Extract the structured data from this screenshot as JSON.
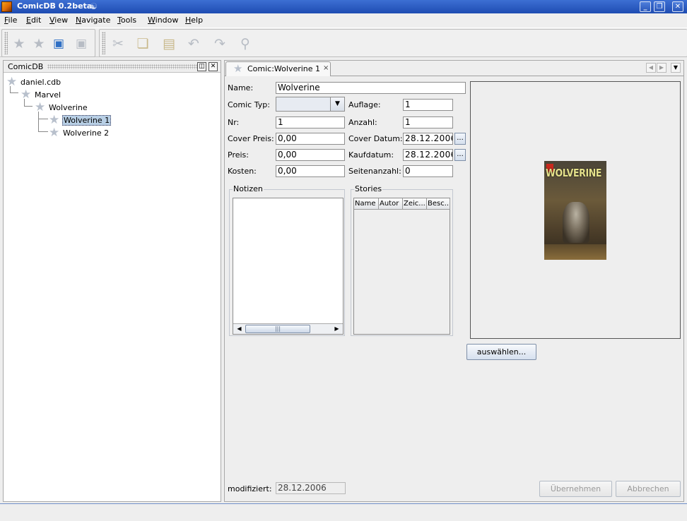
{
  "window": {
    "title": "ComicDB 0.2beta"
  },
  "menu": [
    "File",
    "Edit",
    "View",
    "Navigate",
    "Tools",
    "Window",
    "Help"
  ],
  "toolbar": {
    "icons": [
      "star-icon",
      "star-add-icon",
      "save-icon",
      "save-all-icon",
      "cut-icon",
      "copy-icon",
      "paste-icon",
      "undo-icon",
      "redo-icon",
      "find-icon"
    ]
  },
  "left_panel": {
    "title": "ComicDB",
    "tree": [
      {
        "label": "daniel.cdb",
        "level": 0
      },
      {
        "label": "Marvel",
        "level": 1
      },
      {
        "label": "Wolverine",
        "level": 2
      },
      {
        "label": "Wolverine 1",
        "level": 3,
        "selected": true
      },
      {
        "label": "Wolverine 2",
        "level": 3
      }
    ]
  },
  "tab": {
    "label": "Comic:Wolverine 1",
    "close": "×"
  },
  "form": {
    "name_label": "Name:",
    "name_value": "Wolverine",
    "comic_typ_label": "Comic Typ:",
    "comic_typ_value": "",
    "auflage_label": "Auflage:",
    "auflage_value": "1",
    "nr_label": "Nr:",
    "nr_value": "1",
    "anzahl_label": "Anzahl:",
    "anzahl_value": "1",
    "cover_preis_label": "Cover Preis:",
    "cover_preis_value": "0,00",
    "cover_datum_label": "Cover Datum:",
    "cover_datum_value": "28.12.2006",
    "preis_label": "Preis:",
    "preis_value": "0,00",
    "kaufdatum_label": "Kaufdatum:",
    "kaufdatum_value": "28.12.2006",
    "kosten_label": "Kosten:",
    "kosten_value": "0,00",
    "seitenanzahl_label": "Seitenanzahl:",
    "seitenanzahl_value": "0",
    "dots": "..."
  },
  "notizen": {
    "title": "Notizen",
    "scroll_thumb": "|||"
  },
  "stories": {
    "title": "Stories",
    "columns": [
      "Name",
      "Autor",
      "Zeic...",
      "Besc..."
    ]
  },
  "cover": {
    "masthead": "WOLVERINE"
  },
  "buttons": {
    "select": "auswählen...",
    "apply": "Übernehmen",
    "cancel": "Abbrechen"
  },
  "modified": {
    "label": "modifiziert:",
    "value": "28.12.2006"
  }
}
